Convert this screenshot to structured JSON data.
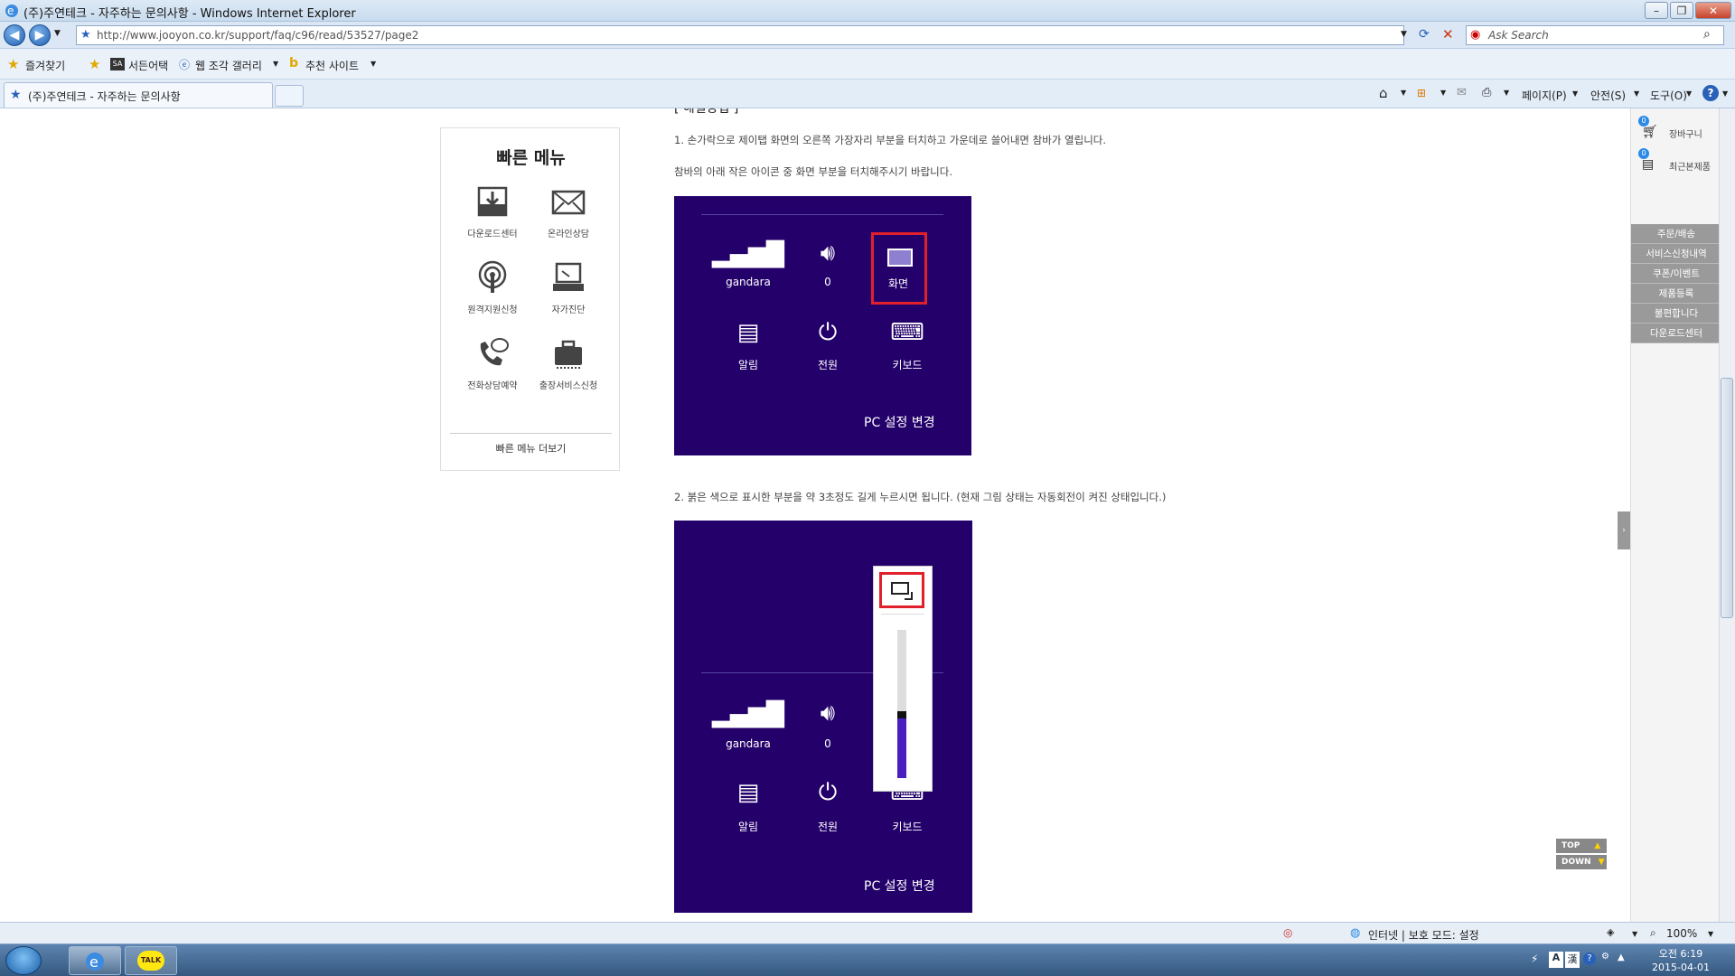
{
  "browser": {
    "title": "(주)주연테크 - 자주하는 문의사항 - Windows Internet Explorer",
    "url": "http://www.jooyon.co.kr/support/faq/c96/read/53527/page2",
    "search_placeholder": "Ask Search",
    "tab_title": "(주)주연테크 - 자주하는 문의사항",
    "favorites": {
      "label": "즐겨찾기",
      "items": [
        "서든어택",
        "웹 조각 갤러리",
        "추천 사이트"
      ]
    },
    "commands": {
      "page": "페이지(P)",
      "safety": "안전(S)",
      "tools": "도구(O)",
      "help": "?"
    }
  },
  "quick_menu": {
    "title": "빠른 메뉴",
    "items": [
      "다운로드센터",
      "온라인상담",
      "원격지원신청",
      "자가진단",
      "전화상담예약",
      "출장서비스신청"
    ],
    "more": "빠른 메뉴 더보기"
  },
  "article": {
    "cut_heading": "[ 해결방법 ]",
    "step1": "1. 손가락으로 제이탭 화면의 오른쪽 가장자리 부분을 터치하고 가운데로 쓸어내면 참바가 열립니다.",
    "step1b": "참바의 아래 작은 아이콘 중 화면 부분을 터치해주시기 바랍니다.",
    "step2": "2. 붉은 색으로 표시한 부분을 약 3초정도 길게 누르시면 됩니다. (현재 그림 상태는 자동회전이 켜진 상태입니다.)",
    "charms1": {
      "items": [
        "gandara",
        "0",
        "화면",
        "알림",
        "전원",
        "키보드"
      ],
      "settings": "PC 설정 변경"
    },
    "charms2": {
      "items": [
        "gandara",
        "0",
        "알림",
        "전원",
        "키보드"
      ],
      "settings": "PC 설정 변경",
      "brightness_level": 0.4
    }
  },
  "right_sidebar": {
    "cart": {
      "count": "0",
      "label": "장바구니"
    },
    "recent": {
      "count": "0",
      "label": "최근본제품"
    },
    "links": [
      "주문/배송",
      "서비스신청내역",
      "쿠폰/이벤트",
      "제품등록",
      "불편합니다",
      "다운로드센터"
    ],
    "top": "TOP",
    "down": "DOWN"
  },
  "status": {
    "zone": "인터넷 | 보호 모드: 설정",
    "zoom": "100%"
  },
  "taskbar": {
    "time": "오전 6:19",
    "date": "2015-04-01",
    "kakao": "TALK"
  }
}
